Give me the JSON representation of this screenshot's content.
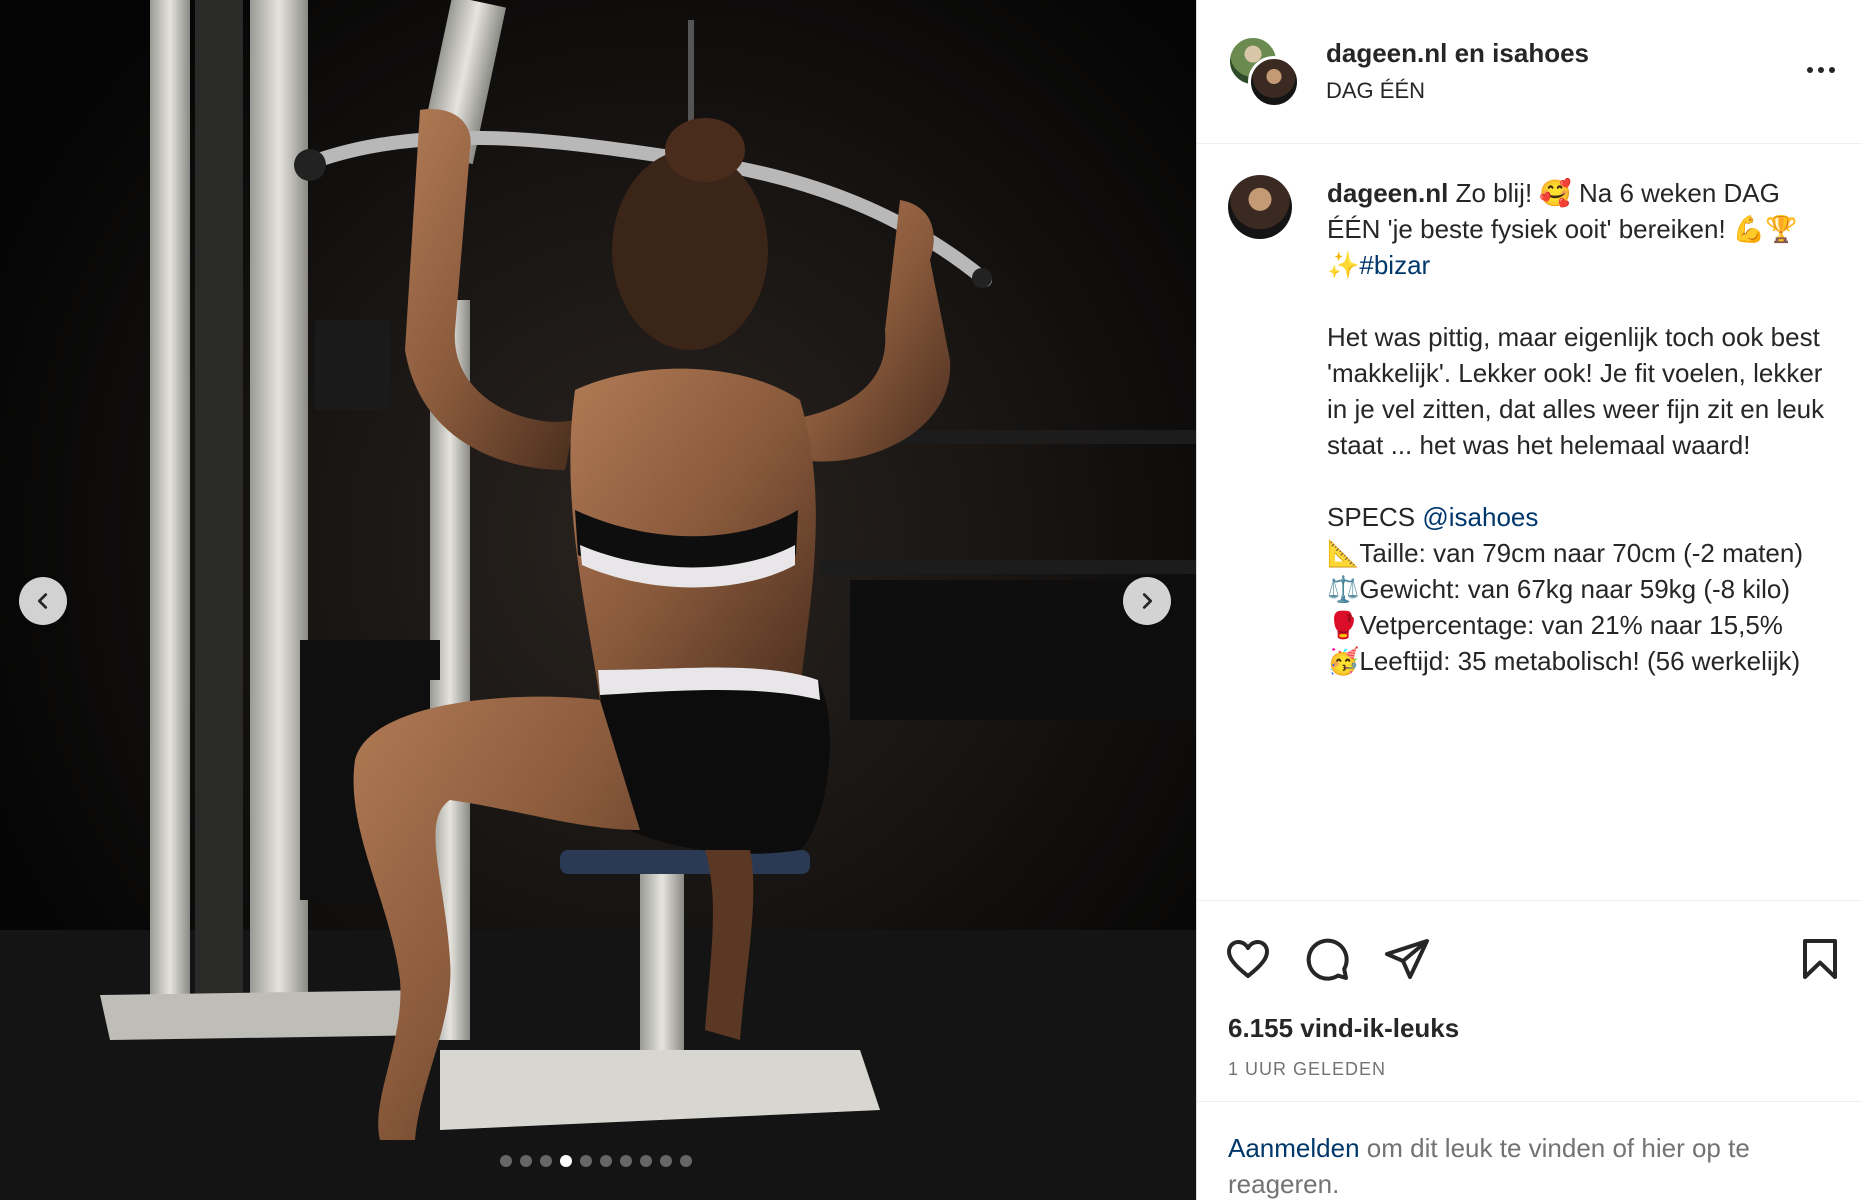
{
  "header": {
    "owner_primary": "dageen.nl",
    "owner_joiner": "en",
    "owner_secondary": "isahoes",
    "location": "DAG ÉÉN",
    "more_icon": "more-horizontal-icon"
  },
  "media": {
    "prev_icon": "chevron-left-icon",
    "next_icon": "chevron-right-icon",
    "slide_count": 10,
    "active_slide": 4
  },
  "caption": {
    "username": "dageen.nl",
    "line1": " Zo blij! 🥰 Na 6 weken DAG ÉÉN 'je beste fysiek ooit' bereiken! 💪🏆✨",
    "hashtag": "#bizar",
    "paragraph2": "Het was pittig, maar eigenlijk toch ook best 'makkelijk'. Lekker ook! Je fit voelen, lekker in je vel zitten, dat alles weer fijn zit en leuk staat ... het was het helemaal waard!",
    "specs_label": "SPECS ",
    "specs_mention": "@isahoes",
    "spec_taille": "📐Taille: van 79cm naar 70cm (-2 maten)",
    "spec_gewicht": "⚖️Gewicht: van 67kg naar 59kg (-8 kilo)",
    "spec_vet": "🥊Vetpercentage: van 21% naar 15,5%",
    "spec_leeftijd": "🥳Leeftijd: 35 metabolisch! (56 werkelijk)"
  },
  "actions": {
    "like_icon": "heart-icon",
    "comment_icon": "comment-icon",
    "share_icon": "send-icon",
    "save_icon": "bookmark-icon"
  },
  "stats": {
    "likes": "6.155 vind-ik-leuks",
    "time": "1 UUR GELEDEN"
  },
  "footer": {
    "login_link": "Aanmelden",
    "login_rest": " om dit leuk te vinden of hier op te reageren."
  }
}
